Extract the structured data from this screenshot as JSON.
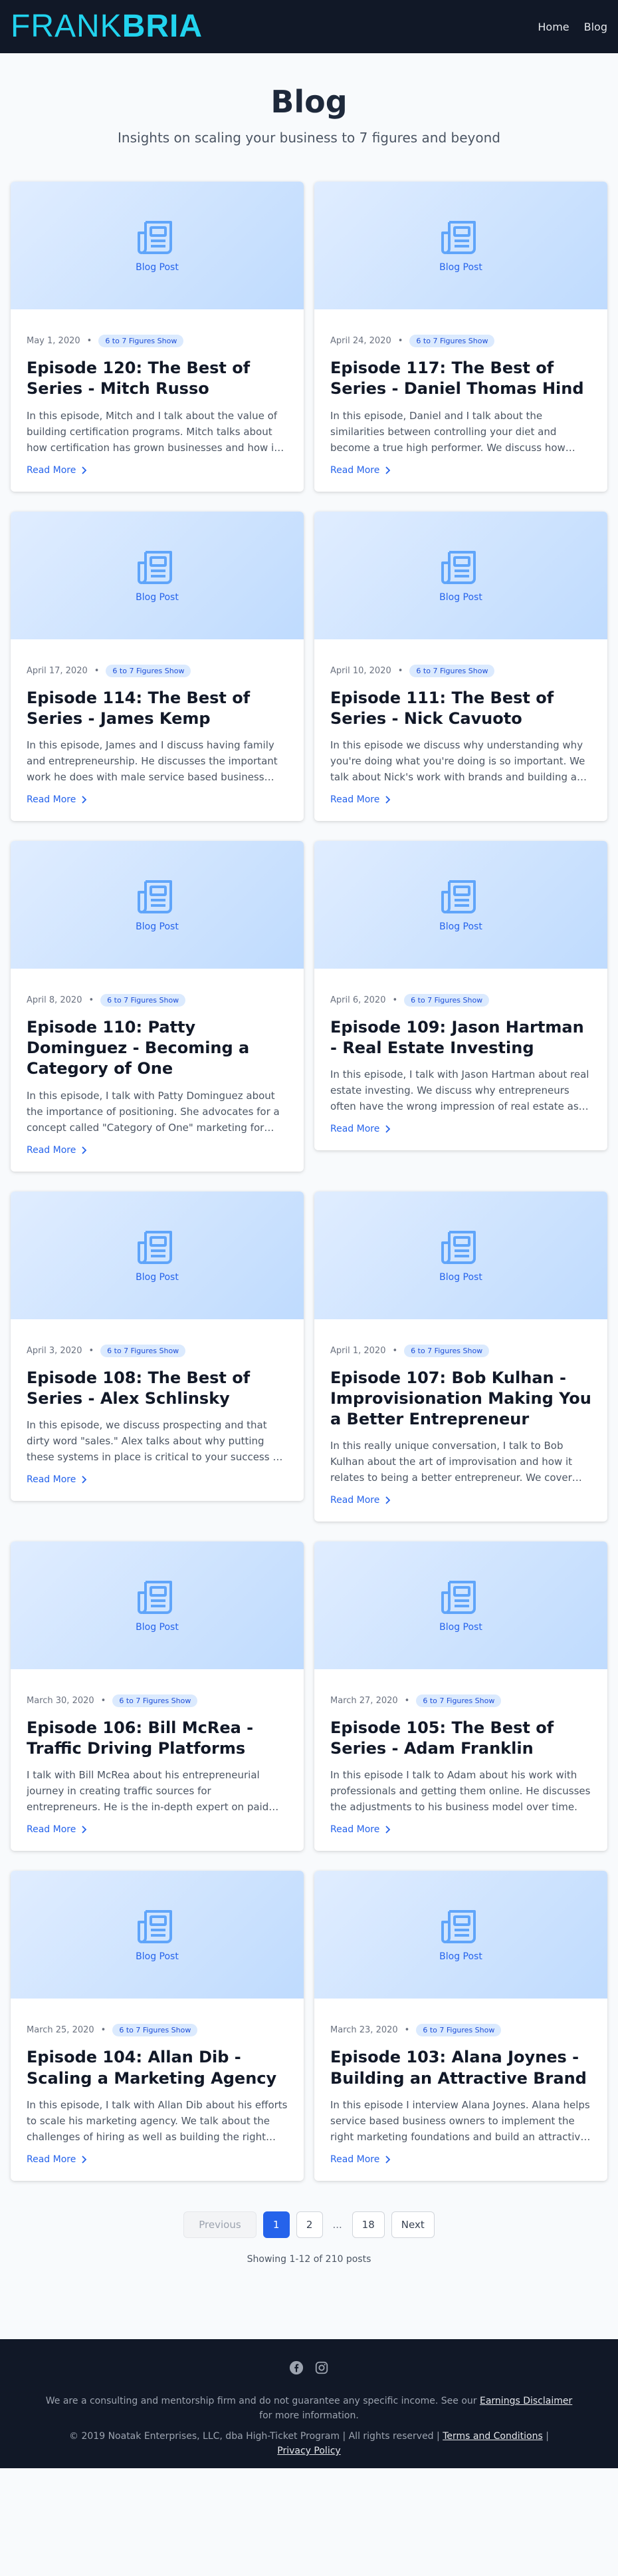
{
  "header": {
    "logo_light": "FRANK",
    "logo_bold": "BRIA",
    "nav": [
      "Home",
      "Blog"
    ]
  },
  "page": {
    "title": "Blog",
    "subtitle": "Insights on scaling your business to 7 figures and beyond"
  },
  "thumb_label": "Blog Post",
  "read_more_label": "Read More",
  "posts": [
    {
      "date": "May 1, 2020",
      "category": "6 to 7 Figures Show",
      "title": "Episode 120: The Best of Series - Mitch Russo",
      "excerpt": "In this episode, Mitch and I talk about the value of building certification programs. Mitch talks about how certification has grown businesses and how it can help yours grow too."
    },
    {
      "date": "April 24, 2020",
      "category": "6 to 7 Figures Show",
      "title": "Episode 117: The Best of Series - Daniel Thomas Hind",
      "excerpt": "In this episode, Daniel and I talk about the similarities between controlling your diet and become a true high performer. We discuss how discipline carries across every area of life."
    },
    {
      "date": "April 17, 2020",
      "category": "6 to 7 Figures Show",
      "title": "Episode 114: The Best of Series - James Kemp",
      "excerpt": "In this episode, James and I discuss having family and entrepreneurship. He discusses the important work he does with male service based business owners."
    },
    {
      "date": "April 10, 2020",
      "category": "6 to 7 Figures Show",
      "title": "Episode 111: The Best of Series - Nick Cavuoto",
      "excerpt": "In this episode we discuss why understanding why you're doing what you're doing is so important. We talk about Nick's work with brands and building a purpose."
    },
    {
      "date": "April 8, 2020",
      "category": "6 to 7 Figures Show",
      "title": "Episode 110: Patty Dominguez - Becoming a Category of One",
      "excerpt": "In this episode, I talk with Patty Dominguez about the importance of positioning. She advocates for a concept called \"Category of One\" marketing for your business."
    },
    {
      "date": "April 6, 2020",
      "category": "6 to 7 Figures Show",
      "title": "Episode 109: Jason Hartman - Real Estate Investing",
      "excerpt": "In this episode, I talk with Jason Hartman about real estate investing. We discuss why entrepreneurs often have the wrong impression of real estate as an asset class."
    },
    {
      "date": "April 3, 2020",
      "category": "6 to 7 Figures Show",
      "title": "Episode 108: The Best of Series - Alex Schlinsky",
      "excerpt": "In this episode, we discuss prospecting and that dirty word \"sales.\" Alex talks about why putting these systems in place is critical to your success as a business owner."
    },
    {
      "date": "April 1, 2020",
      "category": "6 to 7 Figures Show",
      "title": "Episode 107: Bob Kulhan - Improvisionation Making You a Better Entrepreneur",
      "excerpt": "In this really unique conversation, I talk to Bob Kulhan about the art of improvisation and how it relates to being a better entrepreneur. We cover listening and adapting."
    },
    {
      "date": "March 30, 2020",
      "category": "6 to 7 Figures Show",
      "title": "Episode 106: Bill McRea - Traffic Driving Platforms",
      "excerpt": "I talk with Bill McRea about his entrepreneurial journey in creating traffic sources for entrepreneurs. He is the in-depth expert on paid traffic platforms."
    },
    {
      "date": "March 27, 2020",
      "category": "6 to 7 Figures Show",
      "title": "Episode 105: The Best of Series - Adam Franklin",
      "excerpt": "In this episode I talk to Adam about his work with professionals and getting them online. He discusses the adjustments to his business model over time."
    },
    {
      "date": "March 25, 2020",
      "category": "6 to 7 Figures Show",
      "title": "Episode 104: Allan Dib - Scaling a Marketing Agency",
      "excerpt": "In this episode, I talk with Allan Dib about his efforts to scale his marketing agency. We talk about the challenges of hiring as well as building the right systems."
    },
    {
      "date": "March 23, 2020",
      "category": "6 to 7 Figures Show",
      "title": "Episode 103: Alana Joynes - Building an Attractive Brand",
      "excerpt": "In this episode I interview Alana Joynes. Alana helps service based business owners to implement the right marketing foundations and build an attractive brand."
    }
  ],
  "pagination": {
    "previous": "Previous",
    "pages": [
      "1",
      "2"
    ],
    "ellipsis": "...",
    "last": "18",
    "next": "Next",
    "current": 1,
    "showing": "Showing 1-12 of 210 posts"
  },
  "footer": {
    "social_icons": [
      "facebook-icon",
      "instagram-icon"
    ],
    "disclaimer_text": "We are a consulting and mentorship firm and do not guarantee any specific income. See our",
    "disclaimer_link": "Earnings Disclaimer",
    "disclaimer_tail": "for more information.",
    "copyright": "© 2019 Noatak Enterprises, LLC, dba High-Ticket Program | All rights reserved |",
    "terms_link": "Terms and Conditions",
    "separator": "|",
    "privacy_link": "Privacy Policy"
  },
  "colors": {
    "accent": "#2563eb",
    "header_bg": "#111827",
    "logo": "#22d3ee",
    "badge_bg": "#dbeafe"
  }
}
